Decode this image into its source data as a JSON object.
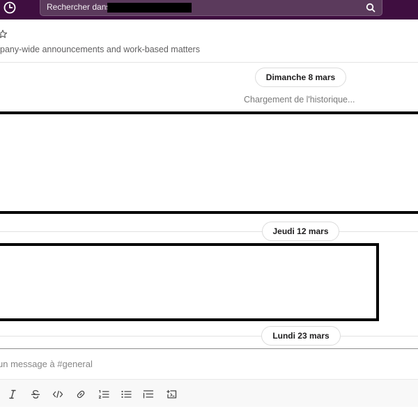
{
  "topbar": {
    "search_placeholder": "Rechercher dans"
  },
  "channel": {
    "topic": "pany-wide announcements and work-based matters"
  },
  "messages": {
    "date_1": "Dimanche 8 mars",
    "loading_text": "Chargement de l'historique...",
    "date_2": "Jeudi 12 mars",
    "date_3": "Lundi 23 mars"
  },
  "composer": {
    "placeholder": "un message à #general"
  },
  "icons": [
    "history-icon",
    "search-icon",
    "star-icon",
    "italic-icon",
    "strikethrough-icon",
    "code-icon",
    "link-icon",
    "ordered-list-icon",
    "bulleted-list-icon",
    "blockquote-icon",
    "code-block-icon"
  ],
  "colors": {
    "topbar_bg": "#3f0e40",
    "search_bg": "#5b3a5c"
  }
}
